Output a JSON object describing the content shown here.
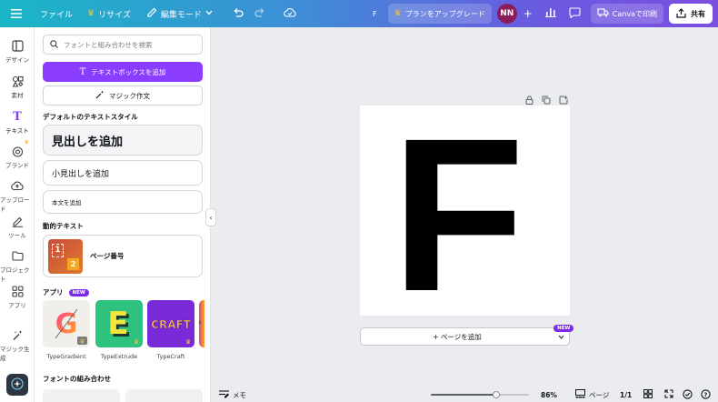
{
  "topbar": {
    "file_label": "ファイル",
    "resize_label": "リサイズ",
    "edit_mode_label": "編集モード",
    "doc_title": "F",
    "upgrade_label": "プランをアップグレード",
    "avatar_initials": "NN",
    "print_label": "Canvaで印刷",
    "share_label": "共有"
  },
  "rail": {
    "design": "デザイン",
    "elements": "素材",
    "text": "テキスト",
    "brand": "ブランド",
    "uploads": "アップロード",
    "tools": "ツール",
    "projects": "プロジェクト",
    "apps": "アプリ",
    "magic": "マジック生成"
  },
  "panel": {
    "search_placeholder": "フォントと組み合わせを検索",
    "add_textbox": "テキストボックスを追加",
    "magic_write": "マジック作文",
    "default_styles_title": "デフォルトのテキストスタイル",
    "heading": "見出しを追加",
    "subheading": "小見出しを追加",
    "body": "本文を追加",
    "dynamic_title": "動的テキスト",
    "page_number": "ページ番号",
    "apps_title": "アプリ",
    "new_badge": "NEW",
    "apps": [
      "TypeGradient",
      "TypeExtrude",
      "TypeCraft"
    ],
    "font_combos_title": "フォントの組み合わせ"
  },
  "canvas": {
    "letter": "F",
    "add_page": "+ ページを追加",
    "new_badge": "NEW"
  },
  "bottombar": {
    "notes": "メモ",
    "zoom": "86%",
    "pages": "ページ",
    "page_count": "1/1",
    "zoom_fraction": 0.67
  },
  "colors": {
    "accent": "#8b3dff",
    "new_badge": "#7d2ae8"
  }
}
